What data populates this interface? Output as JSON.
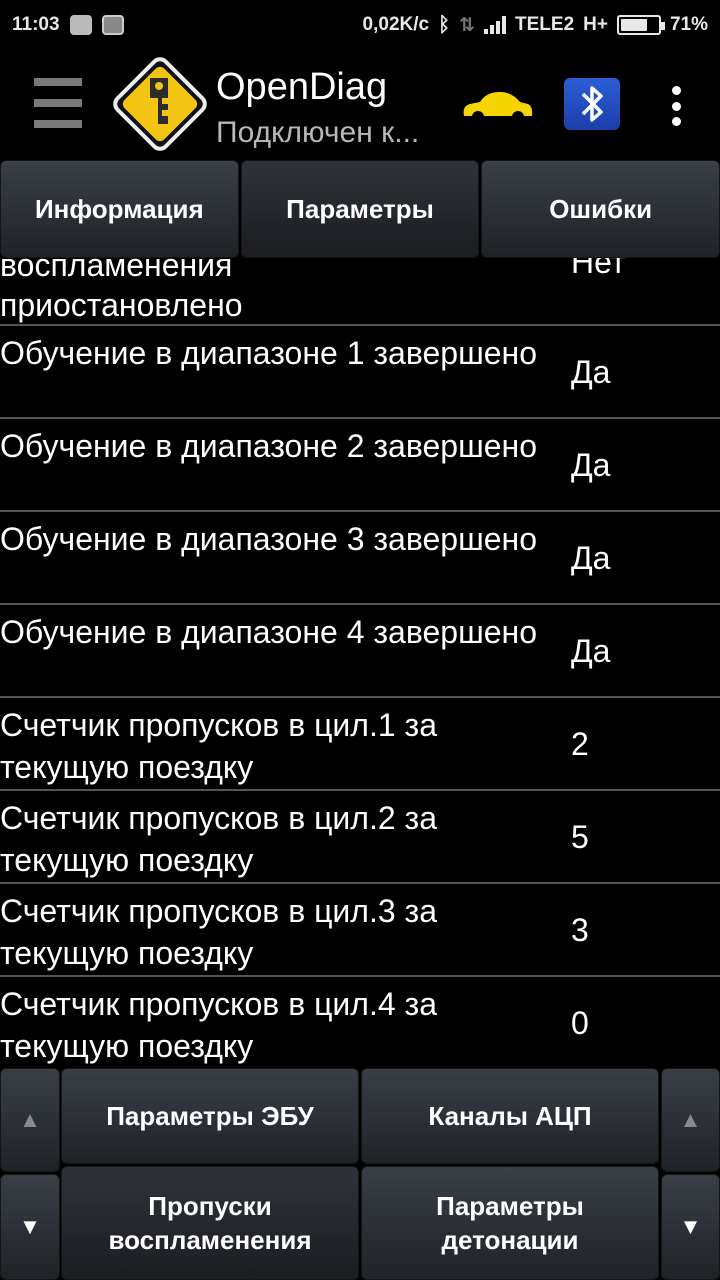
{
  "status_bar": {
    "time": "11:03",
    "speed": "0,02K/c",
    "carrier": "TELE2",
    "network": "H+",
    "battery": "71%",
    "battery_level": 0.71
  },
  "action_bar": {
    "title": "OpenDiag",
    "subtitle": "Подключен к...",
    "icons": [
      "menu-icon",
      "opendiag-key-logo",
      "car-icon",
      "bluetooth-elm327-icon",
      "overflow-menu-icon"
    ],
    "colors": {
      "logo_yellow": "#f3c413",
      "car_yellow": "#f5d400",
      "bt_blue": "#2250c8"
    }
  },
  "tabs": [
    {
      "label": "Информация",
      "active": false
    },
    {
      "label": "Параметры",
      "active": true
    },
    {
      "label": "Ошибки",
      "active": false
    }
  ],
  "params": [
    {
      "name": "воспламенения",
      "value": "Нет"
    },
    {
      "name": "приостановлено",
      "value": ""
    },
    {
      "name": "Обучение в диапазоне 1 завершено",
      "value": "Да"
    },
    {
      "name": "Обучение в диапазоне 2 завершено",
      "value": "Да"
    },
    {
      "name": "Обучение в диапазоне 3 завершено",
      "value": "Да"
    },
    {
      "name": "Обучение в диапазоне 4 завершено",
      "value": "Да"
    },
    {
      "name": "Счетчик пропусков в цил.1 за текущую поездку",
      "value": "2"
    },
    {
      "name": "Счетчик пропусков в цил.2 за текущую поездку",
      "value": "5"
    },
    {
      "name": "Счетчик пропусков в цил.3 за текущую поездку",
      "value": "3"
    },
    {
      "name": "Счетчик пропусков в цил.4 за текущую поездку",
      "value": "0"
    }
  ],
  "bottom_nav": {
    "ecu_params": "Параметры ЭБУ",
    "adc_channels": "Каналы АЦП",
    "misfires": "Пропуски воспламенения",
    "knock_params": "Параметры детонации",
    "up_arrow": "▲",
    "down_arrow": "▼"
  }
}
